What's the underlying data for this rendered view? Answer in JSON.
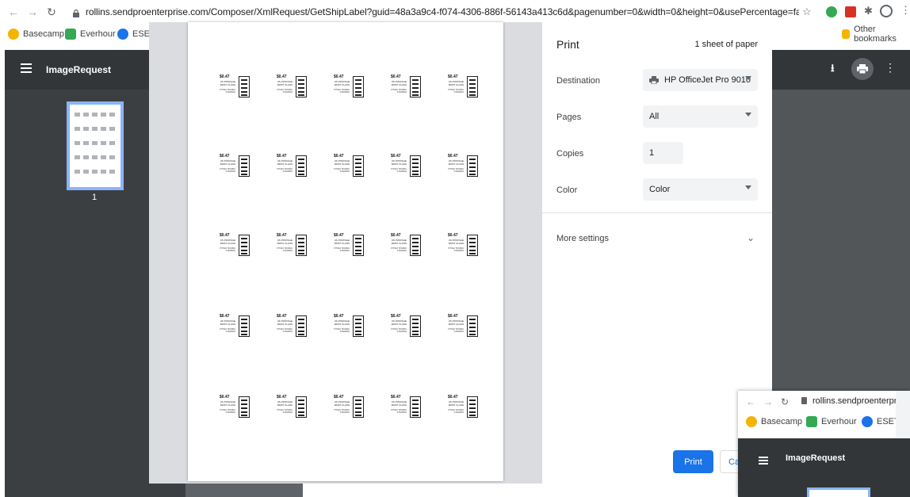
{
  "browser": {
    "url": "rollins.sendproenterprise.com/Composer/XmlRequest/GetShipLabel?guid=48a3a9c4-f074-4306-886f-56143a413c6d&pagenumber=0&width=0&height=0&usePercentage=false&mimetype...",
    "bookmarks": [
      {
        "label": "Basecamp",
        "color": "#f4b400"
      },
      {
        "label": "Everhour",
        "color": "#34a853"
      },
      {
        "label": "ESET",
        "color": "#1a73e8"
      }
    ],
    "other_bookmarks": "Other bookmarks"
  },
  "pdf_viewer": {
    "title": "ImageRequest",
    "page_number": "1"
  },
  "print_dialog": {
    "title": "Print",
    "sheet_count": "1 sheet of paper",
    "destination_label": "Destination",
    "destination_value": "HP OfficeJet Pro 9010",
    "pages_label": "Pages",
    "pages_value": "All",
    "copies_label": "Copies",
    "copies_value": "1",
    "color_label": "Color",
    "color_value": "Color",
    "more_settings": "More settings",
    "print_button": "Print",
    "cancel_button": "Ca"
  },
  "label_sheet": {
    "price": "$0.47",
    "line1": "US POSTAGE",
    "line2": "FIRST CLASS",
    "line3": "PITNEY BOWES",
    "line4": "STAMPED"
  },
  "overlap_window": {
    "url": "rollins.sendproenterpr",
    "bookmarks": [
      "Basecamp",
      "Everhour",
      "ESET"
    ],
    "title": "ImageRequest"
  },
  "colors": {
    "accent": "#1a73e8",
    "toolbar": "#323639",
    "viewer_bg": "#525659"
  }
}
